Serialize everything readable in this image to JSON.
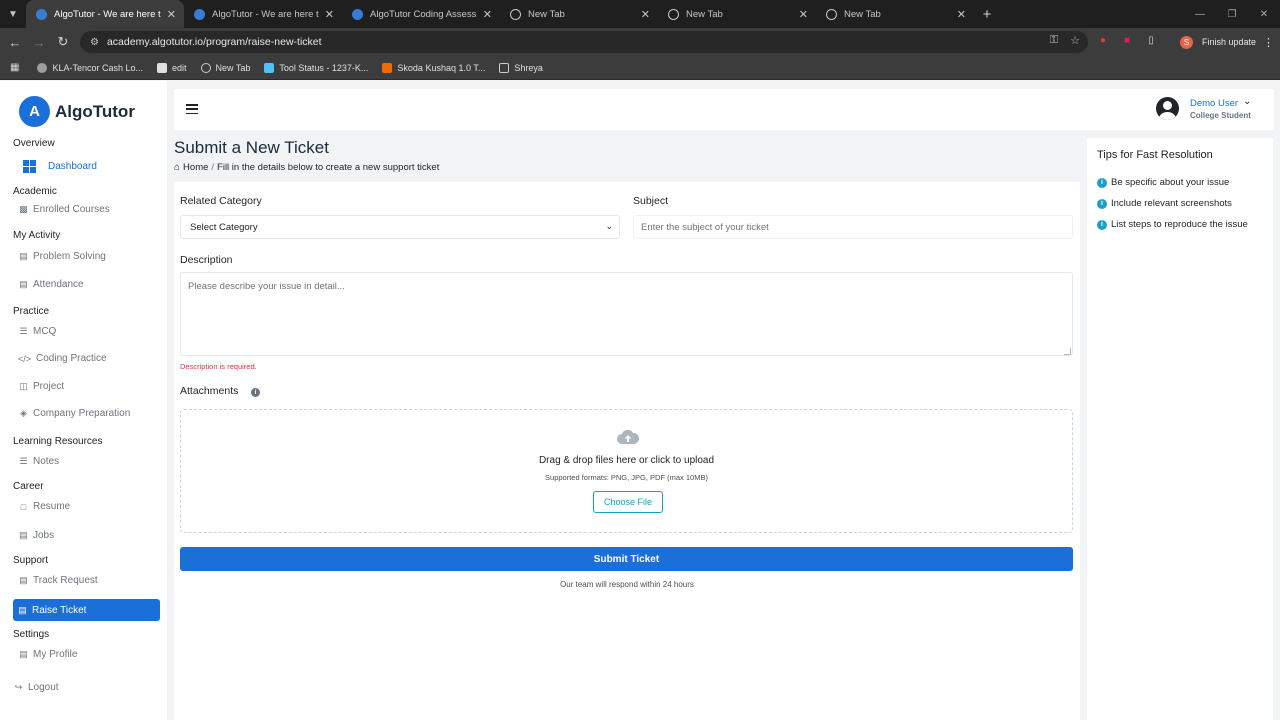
{
  "browser": {
    "tabs": [
      {
        "title": "AlgoTutor - We are here to bu",
        "active": true
      },
      {
        "title": "AlgoTutor - We are here to bu",
        "active": false
      },
      {
        "title": "AlgoTutor Coding Assessment",
        "active": false
      },
      {
        "title": "New Tab",
        "active": false
      },
      {
        "title": "New Tab",
        "active": false
      },
      {
        "title": "New Tab",
        "active": false
      }
    ],
    "url": "academy.algotutor.io/program/raise-new-ticket",
    "finish_update": "Finish update",
    "profile_initial": "S",
    "bookmarks": [
      "KLA-Tencor Cash Lo...",
      "edit",
      "New Tab",
      "Tool Status - 1237-K...",
      "Skoda Kushaq 1.0 T...",
      "Shreya"
    ]
  },
  "brand": {
    "name": "AlgoTutor",
    "accent": "#1b6fd8"
  },
  "sidebar": {
    "overview": "Overview",
    "dashboard": "Dashboard",
    "academic": "Academic",
    "enrolled_courses": "Enrolled Courses",
    "my_activity": "My Activity",
    "problem_solving": "Problem Solving",
    "attendance": "Attendance",
    "practice": "Practice",
    "mcq": "MCQ",
    "coding_practice": "Coding Practice",
    "project": "Project",
    "company_preparation": "Company Preparation",
    "learning_resources": "Learning Resources",
    "notes": "Notes",
    "career": "Career",
    "resume": "Resume",
    "jobs": "Jobs",
    "support": "Support",
    "track_request": "Track Request",
    "raise_ticket": "Raise Ticket",
    "settings": "Settings",
    "my_profile": "My Profile",
    "logout": "Logout"
  },
  "header": {
    "user_name": "Demo User",
    "user_role": "College Student"
  },
  "page": {
    "title": "Submit a New Ticket",
    "breadcrumb_home": "Home",
    "breadcrumb_sep": "/",
    "breadcrumb_text": "Fill in the details below to create a new support ticket"
  },
  "form": {
    "category_label": "Related Category",
    "category_value": "Select Category",
    "subject_label": "Subject",
    "subject_placeholder": "Enter the subject of your ticket",
    "description_label": "Description",
    "description_placeholder": "Please describe your issue in detail...",
    "description_error": "Description is required.",
    "attachments_label": "Attachments",
    "dropzone_text": "Drag & drop files here or click to upload",
    "dropzone_formats": "Supported formats: PNG, JPG, PDF (max 10MB)",
    "choose_file": "Choose File",
    "submit": "Submit Ticket",
    "respond_note": "Our team will respond within 24 hours"
  },
  "tips": {
    "title": "Tips for Fast Resolution",
    "items": [
      "Be specific about your issue",
      "Include relevant screenshots",
      "List steps to reproduce the issue"
    ]
  }
}
